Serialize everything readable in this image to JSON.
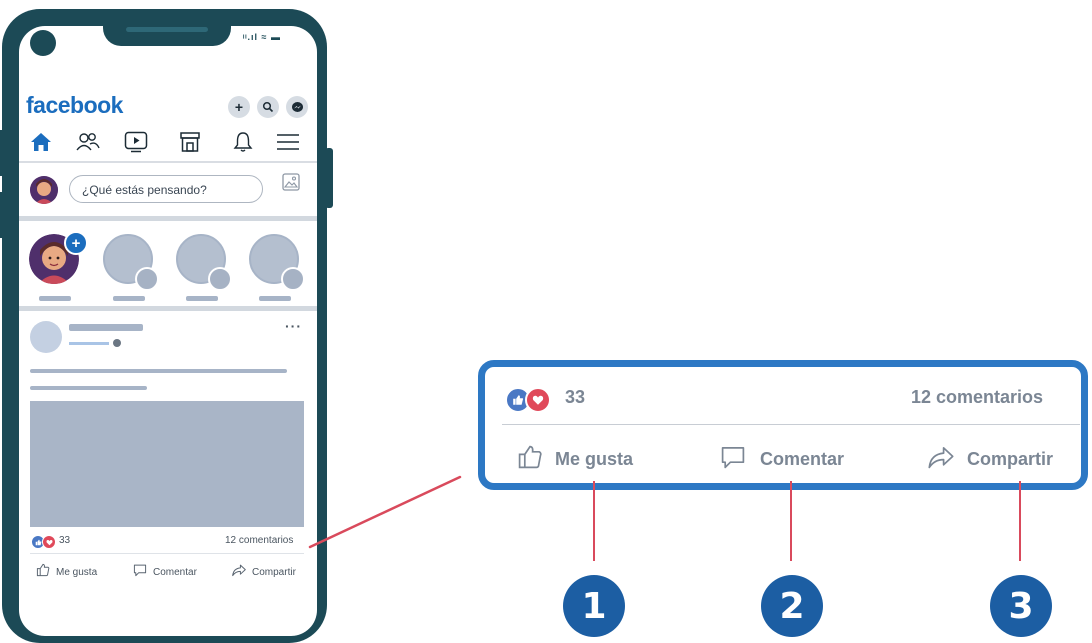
{
  "app": {
    "logo": "facebook",
    "status_icons": "ᵎᵎ.ıl ≈ ▬"
  },
  "composer": {
    "placeholder": "¿Qué estás pensando?"
  },
  "post": {
    "reactions_count": "33",
    "comments": "12 comentarios",
    "actions": {
      "like": "Me gusta",
      "comment": "Comentar",
      "share": "Compartir"
    }
  },
  "zoom": {
    "reactions_count": "33",
    "comments": "12 comentarios",
    "actions": {
      "like": "Me gusta",
      "comment": "Comentar",
      "share": "Compartir"
    }
  },
  "callouts": [
    "1",
    "2",
    "3"
  ],
  "colors": {
    "brand": "#1b6dbe",
    "phone": "#1c4a56",
    "highlight": "#2d78c4",
    "pointer": "#d94a5c",
    "badge": "#1c5ea3"
  },
  "icons": [
    "plus-icon",
    "search-icon",
    "messenger-icon",
    "home-icon",
    "friends-icon",
    "video-icon",
    "marketplace-icon",
    "bell-icon",
    "menu-icon",
    "photo-icon",
    "like-icon",
    "comment-icon",
    "share-icon"
  ]
}
